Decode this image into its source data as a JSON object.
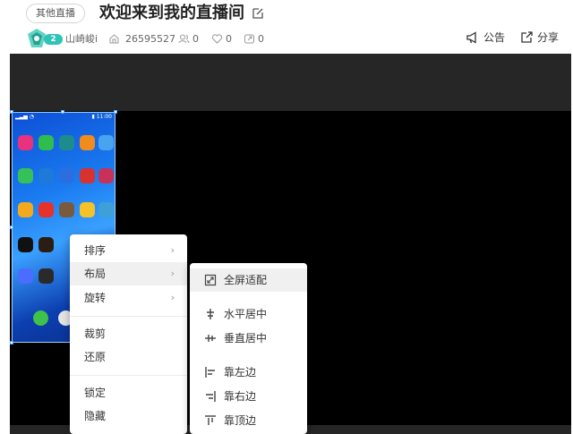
{
  "header": {
    "category_tag": "其他直播",
    "room_title": "欢迎来到我的直播间",
    "anchor": {
      "level": "2",
      "name": "山崎峻i"
    },
    "stats": {
      "room_id": "26595527",
      "followers": "0",
      "likes": "0",
      "shares": "0"
    },
    "actions": {
      "notice_label": "公告",
      "share_label": "分享"
    }
  },
  "phone": {
    "apps": [
      {
        "label": "",
        "color": "#e8327d"
      },
      {
        "label": "",
        "color": "#2fbd4d"
      },
      {
        "label": "",
        "color": "#1e8c8c"
      },
      {
        "label": "",
        "color": "#f08c1e"
      },
      {
        "label": "",
        "color": "#4aa3f0"
      },
      {
        "label": "",
        "color": "#35c05a"
      },
      {
        "label": "",
        "color": "#1d7ad8"
      },
      {
        "label": "",
        "color": "#2a6ee0"
      },
      {
        "label": "",
        "color": "#d8322e"
      },
      {
        "label": "",
        "color": "#c8325a"
      },
      {
        "label": "",
        "color": "#f2a91e"
      },
      {
        "label": "",
        "color": "#e6322a"
      },
      {
        "label": "",
        "color": "#7a5a3c"
      },
      {
        "label": "",
        "color": "#f5c22a"
      },
      {
        "label": "",
        "color": "#3fa0d8"
      }
    ]
  },
  "context_menu": {
    "items": [
      "排序",
      "布局",
      "旋转",
      "裁剪",
      "还原",
      "锁定",
      "隐藏"
    ],
    "arrow": "›"
  },
  "layout_submenu": {
    "items": [
      "全屏适配",
      "水平居中",
      "垂直居中",
      "靠左边",
      "靠右边",
      "靠顶边"
    ]
  },
  "colors": {
    "accent": "#2ec4b6",
    "stage": "#262626",
    "video": "#000000"
  }
}
